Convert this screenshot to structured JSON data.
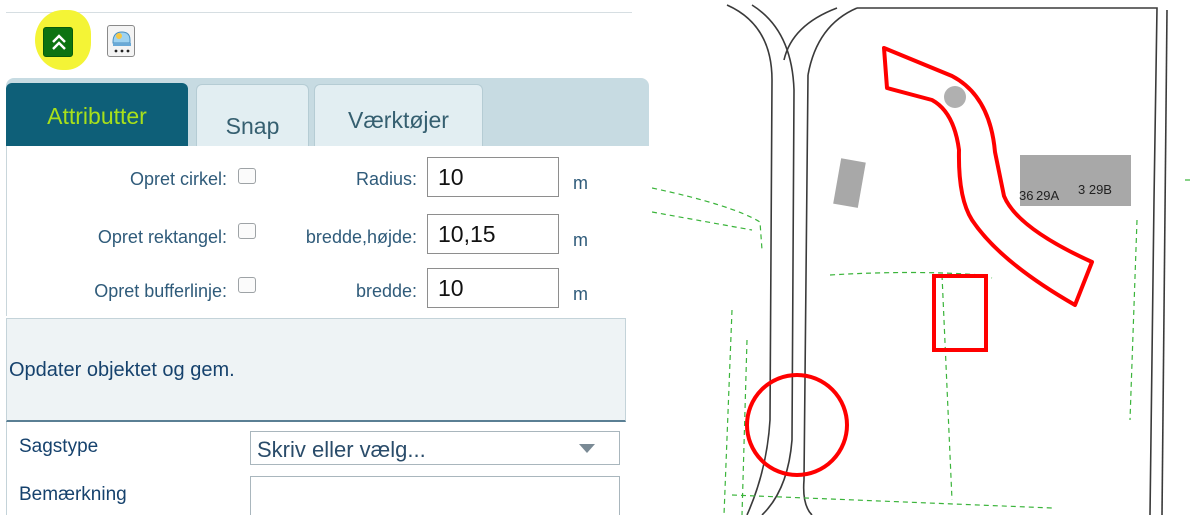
{
  "toolbar": {
    "collapse_icon": "double-chevron-up-icon",
    "style_icon": "style-editor-icon",
    "highlight_color": "#f4f436",
    "collapse_color": "#0d7311"
  },
  "tabs": {
    "attributter": "Attributter",
    "snap": "Snap",
    "vaerktojer": "Værktøjer",
    "active": "Attributter",
    "active_color": "#0e5f78",
    "active_text_color": "#a8e01a"
  },
  "form": {
    "rows": [
      {
        "label": "Opret cirkel:",
        "field_label": "Radius:",
        "value": "10",
        "unit": "m",
        "checked": false
      },
      {
        "label": "Opret rektangel:",
        "field_label": "bredde,højde:",
        "value": "10,15",
        "unit": "m",
        "checked": false
      },
      {
        "label": "Opret bufferlinje:",
        "field_label": "bredde:",
        "value": "10",
        "unit": "m",
        "checked": false
      }
    ]
  },
  "update": {
    "title": "Opdater objektet og gem."
  },
  "details": {
    "sagstype_label": "Sagstype",
    "sagstype_value": "Skriv eller vælg...",
    "bemaerkning_label": "Bemærkning",
    "bemaerkning_value": ""
  },
  "map": {
    "labels": [
      "36",
      "29A",
      "3 29B"
    ],
    "drawing_color": "#ff0000",
    "building_color": "#a8a8a8",
    "parcel_line_color": "#3ab43a"
  }
}
